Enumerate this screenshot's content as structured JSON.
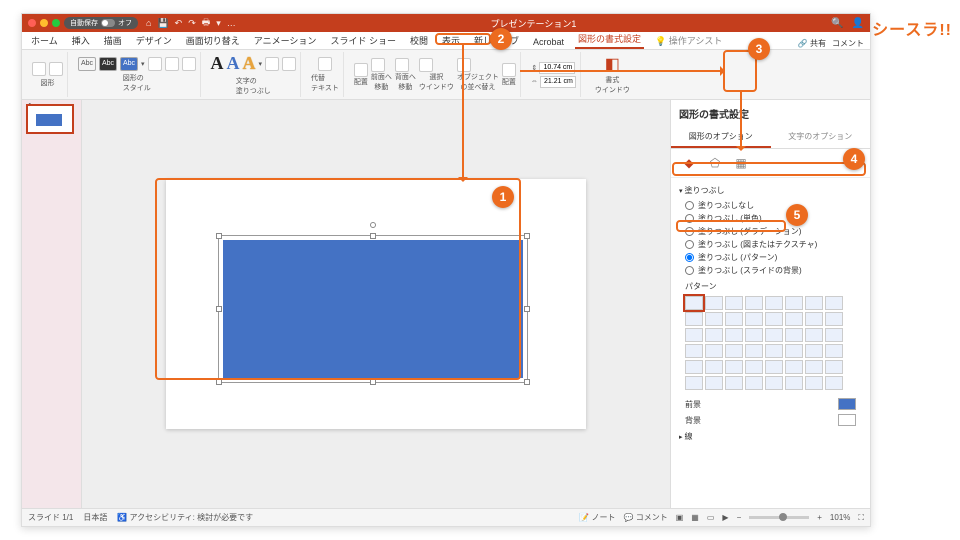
{
  "brand": "シースラ!!",
  "titlebar": {
    "autosave": "自動保存",
    "autosave_state": "オフ",
    "docTitle": "プレゼンテーション1"
  },
  "tabs": [
    "ホーム",
    "挿入",
    "描画",
    "デザイン",
    "画面切り替え",
    "アニメーション",
    "スライド ショー",
    "校閲",
    "表示",
    "新しいタブ",
    "Acrobat",
    "図形の書式設定",
    "操作アシスト"
  ],
  "tabs_activeIndex": 11,
  "tabbar_right": {
    "share": "共有",
    "comment": "コメント"
  },
  "ribbon": {
    "shapes_label": "図形",
    "styles_label": "図形の\nスタイル",
    "abc": "Abc",
    "wordart_label": "文字の\n塗りつぶし",
    "alttext": "代替\nテキスト",
    "arrange": [
      "配置",
      "前面へ\n移動",
      "背面へ\n移動",
      "選択\nウインドウ",
      "オブジェクト\nの並べ替え",
      "配置"
    ],
    "size_h": "10.74 cm",
    "size_w": "21.21 cm",
    "format_pane": "書式\nウインドウ"
  },
  "thumb_index": "1",
  "format_pane": {
    "title": "図形の書式設定",
    "tab_shape": "図形のオプション",
    "tab_text": "文字のオプション",
    "fill_head": "塗りつぶし",
    "fills": [
      "塗りつぶしなし",
      "塗りつぶし (単色)",
      "塗りつぶし (グラデーション)",
      "塗りつぶし (図またはテクスチャ)",
      "塗りつぶし (パターン)",
      "塗りつぶし (スライドの背景)"
    ],
    "fills_selectedIndex": 4,
    "pattern_label": "パターン",
    "fg": "前景",
    "bg": "背景",
    "line_head": "線"
  },
  "status": {
    "slide": "スライド 1/1",
    "lang": "日本語",
    "a11y": "アクセシビリティ: 検討が必要です",
    "notes": "ノート",
    "comments": "コメント",
    "zoom": "101%"
  },
  "callouts": {
    "c1": "1",
    "c2": "2",
    "c3": "3",
    "c4": "4",
    "c5": "5"
  }
}
